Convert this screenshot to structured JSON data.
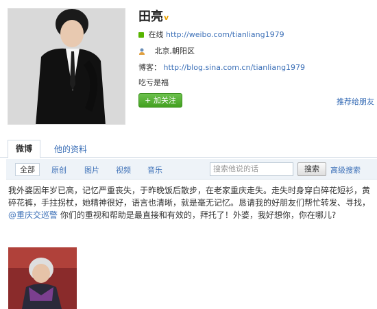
{
  "profile": {
    "name": "田亮",
    "verified_badge": "v",
    "online_label": "在线",
    "weibo_url": "http://weibo.com/tianliang1979",
    "location": "北京,朝阳区",
    "blog_label": "博客：",
    "blog_url": "http://blog.sina.com.cn/tianliang1979",
    "bio": "吃亏是福",
    "follow_button": "+ 加关注",
    "recommend_link": "推荐给朋友"
  },
  "tabs": [
    {
      "label": "微博",
      "active": true
    },
    {
      "label": "他的资料",
      "active": false
    }
  ],
  "filters": {
    "items": [
      "全部",
      "原创",
      "图片",
      "视频",
      "音乐"
    ],
    "search_placeholder": "搜索他说的话",
    "search_button": "搜索",
    "advanced_search": "高级搜索"
  },
  "post": {
    "text_before": "我外婆因年岁已高，记忆严重丧失，于昨晚饭后散步，在老家重庆走失。走失时身穿白碎花短衫，黄碎花裤，手拄拐杖，她精神很好，语言也清晰，就是毫无记忆。恳请我的好朋友们帮忙转发、寻找，",
    "mention": "@重庆交巡警",
    "text_after": " 你们的重视和帮助是最直接和有效的，拜托了！外婆，我好想你，你在哪儿?"
  },
  "colors": {
    "link": "#3b6fb7",
    "follow_green": "#4caf2a",
    "filter_bg": "#eef3f8"
  }
}
